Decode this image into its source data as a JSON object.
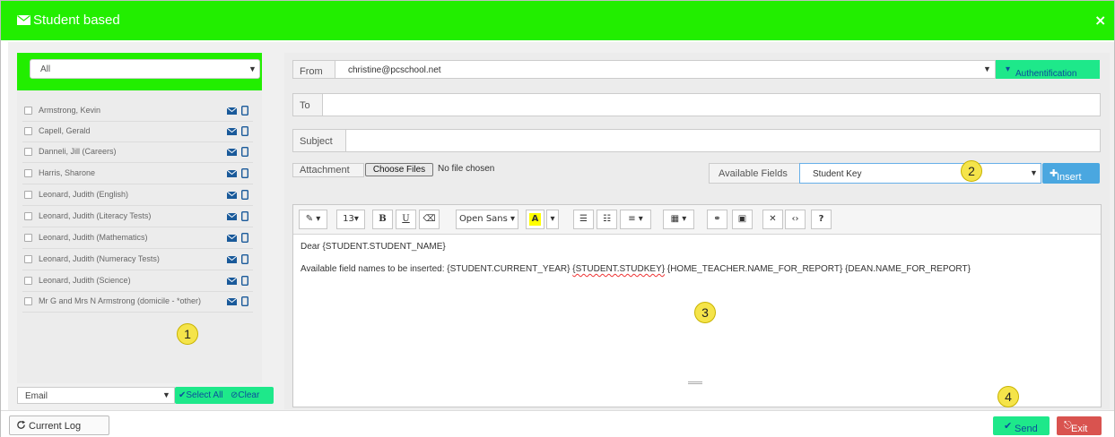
{
  "window": {
    "title": "Student based",
    "close": "×"
  },
  "left_panel": {
    "filter": "All",
    "recipients": [
      "Armstrong, Kevin",
      "Capell, Gerald",
      "Danneli, Jill (Careers)",
      "Harris, Sharone",
      "Leonard, Judith (English)",
      "Leonard, Judith (Literacy Tests)",
      "Leonard, Judith (Mathematics)",
      "Leonard, Judith (Numeracy Tests)",
      "Leonard, Judith (Science)",
      "Mr G and Mrs N Armstrong (domicile - *other)"
    ],
    "mode": "Email",
    "select_all": "Select All",
    "clear": "Clear"
  },
  "form": {
    "from_label": "From",
    "from_value": "christine@pcschool.net",
    "auth_label": "Authentification",
    "to_label": "To",
    "to_value": "",
    "subject_label": "Subject",
    "subject_value": "",
    "attachment_label": "Attachment",
    "choose_files": "Choose Files",
    "no_file": "No file chosen",
    "available_fields_label": "Available Fields",
    "available_fields_value": "Student Key",
    "insert": "Insert"
  },
  "editor": {
    "toolbar": {
      "font_size": "13",
      "bold": "B",
      "underline": "U",
      "font_name": "Open Sans",
      "color": "A",
      "help": "?"
    },
    "line1": "Dear {STUDENT.STUDENT_NAME}",
    "line2_prefix": "Available field names to be inserted:  {STUDENT.CURRENT_YEAR}  ",
    "line2_studkey": "{STUDENT.STUDKEY}",
    "line2_suffix": "  {HOME_TEACHER.NAME_FOR_REPORT}  {DEAN.NAME_FOR_REPORT}"
  },
  "footer": {
    "current_log": "Current Log",
    "send": "Send",
    "exit": "Exit"
  },
  "badges": {
    "b1": "1",
    "b2": "2",
    "b3": "3",
    "b4": "4"
  },
  "colors": {
    "title_green": "#22ee00",
    "action_green": "#1ee88a",
    "exit_red": "#d9534f",
    "insert_blue": "#4aa7e0"
  }
}
